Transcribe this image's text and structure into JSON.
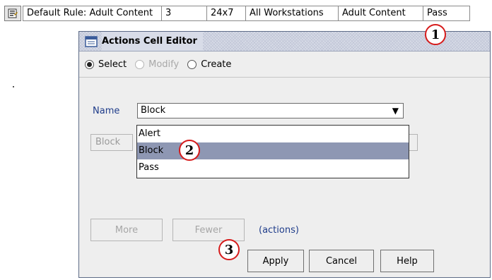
{
  "rule_row": {
    "cells": [
      "Default Rule: Adult Content",
      "3",
      "24x7",
      "All Workstations",
      "Adult Content",
      "Pass"
    ]
  },
  "dialog": {
    "title": "Actions Cell Editor",
    "modes": [
      {
        "label": "Select",
        "selected": true,
        "disabled": false
      },
      {
        "label": "Modify",
        "selected": false,
        "disabled": true
      },
      {
        "label": "Create",
        "selected": false,
        "disabled": false
      }
    ],
    "name_label": "Name",
    "name_value": "Block",
    "dropdown_options": [
      "Alert",
      "Block",
      "Pass"
    ],
    "highlighted_option": "Block",
    "secondary_select_value": "Block",
    "more_label": "More",
    "fewer_label": "Fewer",
    "actions_text": "(actions)",
    "apply_label": "Apply",
    "cancel_label": "Cancel",
    "help_label": "Help"
  },
  "callouts": [
    "1",
    "2",
    "3"
  ],
  "colors": {
    "accent_text": "#1f3c8a",
    "highlight": "#8e97b3",
    "callout_border": "#d61b1b"
  }
}
